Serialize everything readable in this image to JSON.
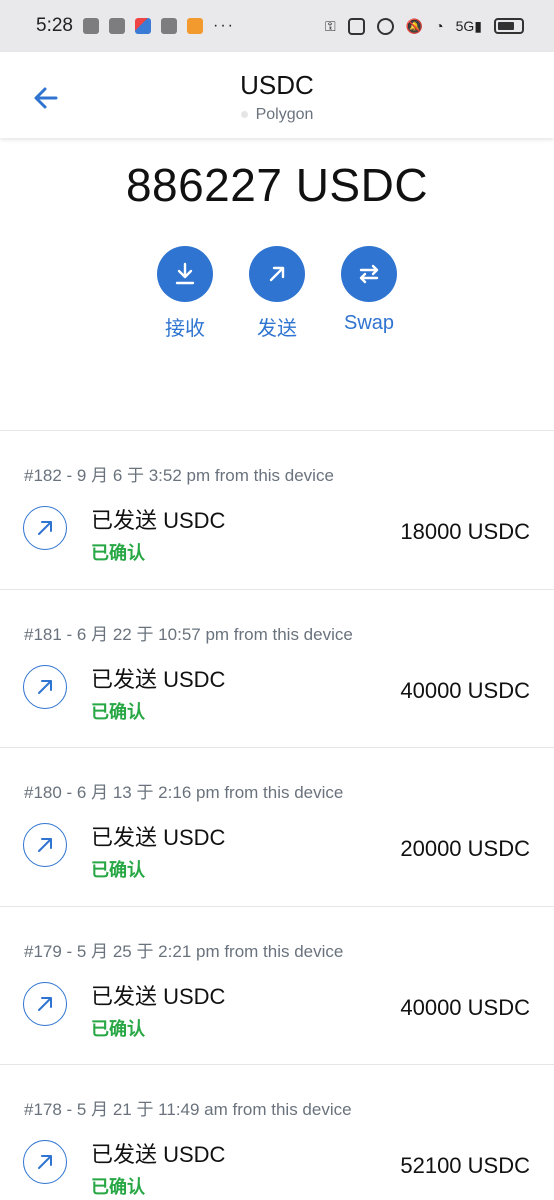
{
  "status_bar": {
    "time": "5:28",
    "dots": "···",
    "network_label": "5G"
  },
  "header": {
    "title": "USDC",
    "network": "Polygon"
  },
  "balance": "886227 USDC",
  "actions": [
    {
      "label": "接收",
      "icon": "receive-icon"
    },
    {
      "label": "发送",
      "icon": "send-icon"
    },
    {
      "label": "Swap",
      "icon": "swap-icon"
    }
  ],
  "transactions": [
    {
      "meta": "#182 - 9 月 6 于 3:52 pm from this device",
      "name": "已发送 USDC",
      "status": "已确认",
      "amount": "18000 USDC"
    },
    {
      "meta": "#181 - 6 月 22 于 10:57 pm from this device",
      "name": "已发送 USDC",
      "status": "已确认",
      "amount": "40000 USDC"
    },
    {
      "meta": "#180 - 6 月 13 于 2:16 pm from this device",
      "name": "已发送 USDC",
      "status": "已确认",
      "amount": "20000 USDC"
    },
    {
      "meta": "#179 - 5 月 25 于 2:21 pm from this device",
      "name": "已发送 USDC",
      "status": "已确认",
      "amount": "40000 USDC"
    },
    {
      "meta": "#178 - 5 月 21 于 11:49 am from this device",
      "name": "已发送 USDC",
      "status": "已确认",
      "amount": "52100 USDC"
    }
  ],
  "colors": {
    "accent": "#2f74d0",
    "confirmed": "#28a745",
    "muted": "#6a737d"
  }
}
